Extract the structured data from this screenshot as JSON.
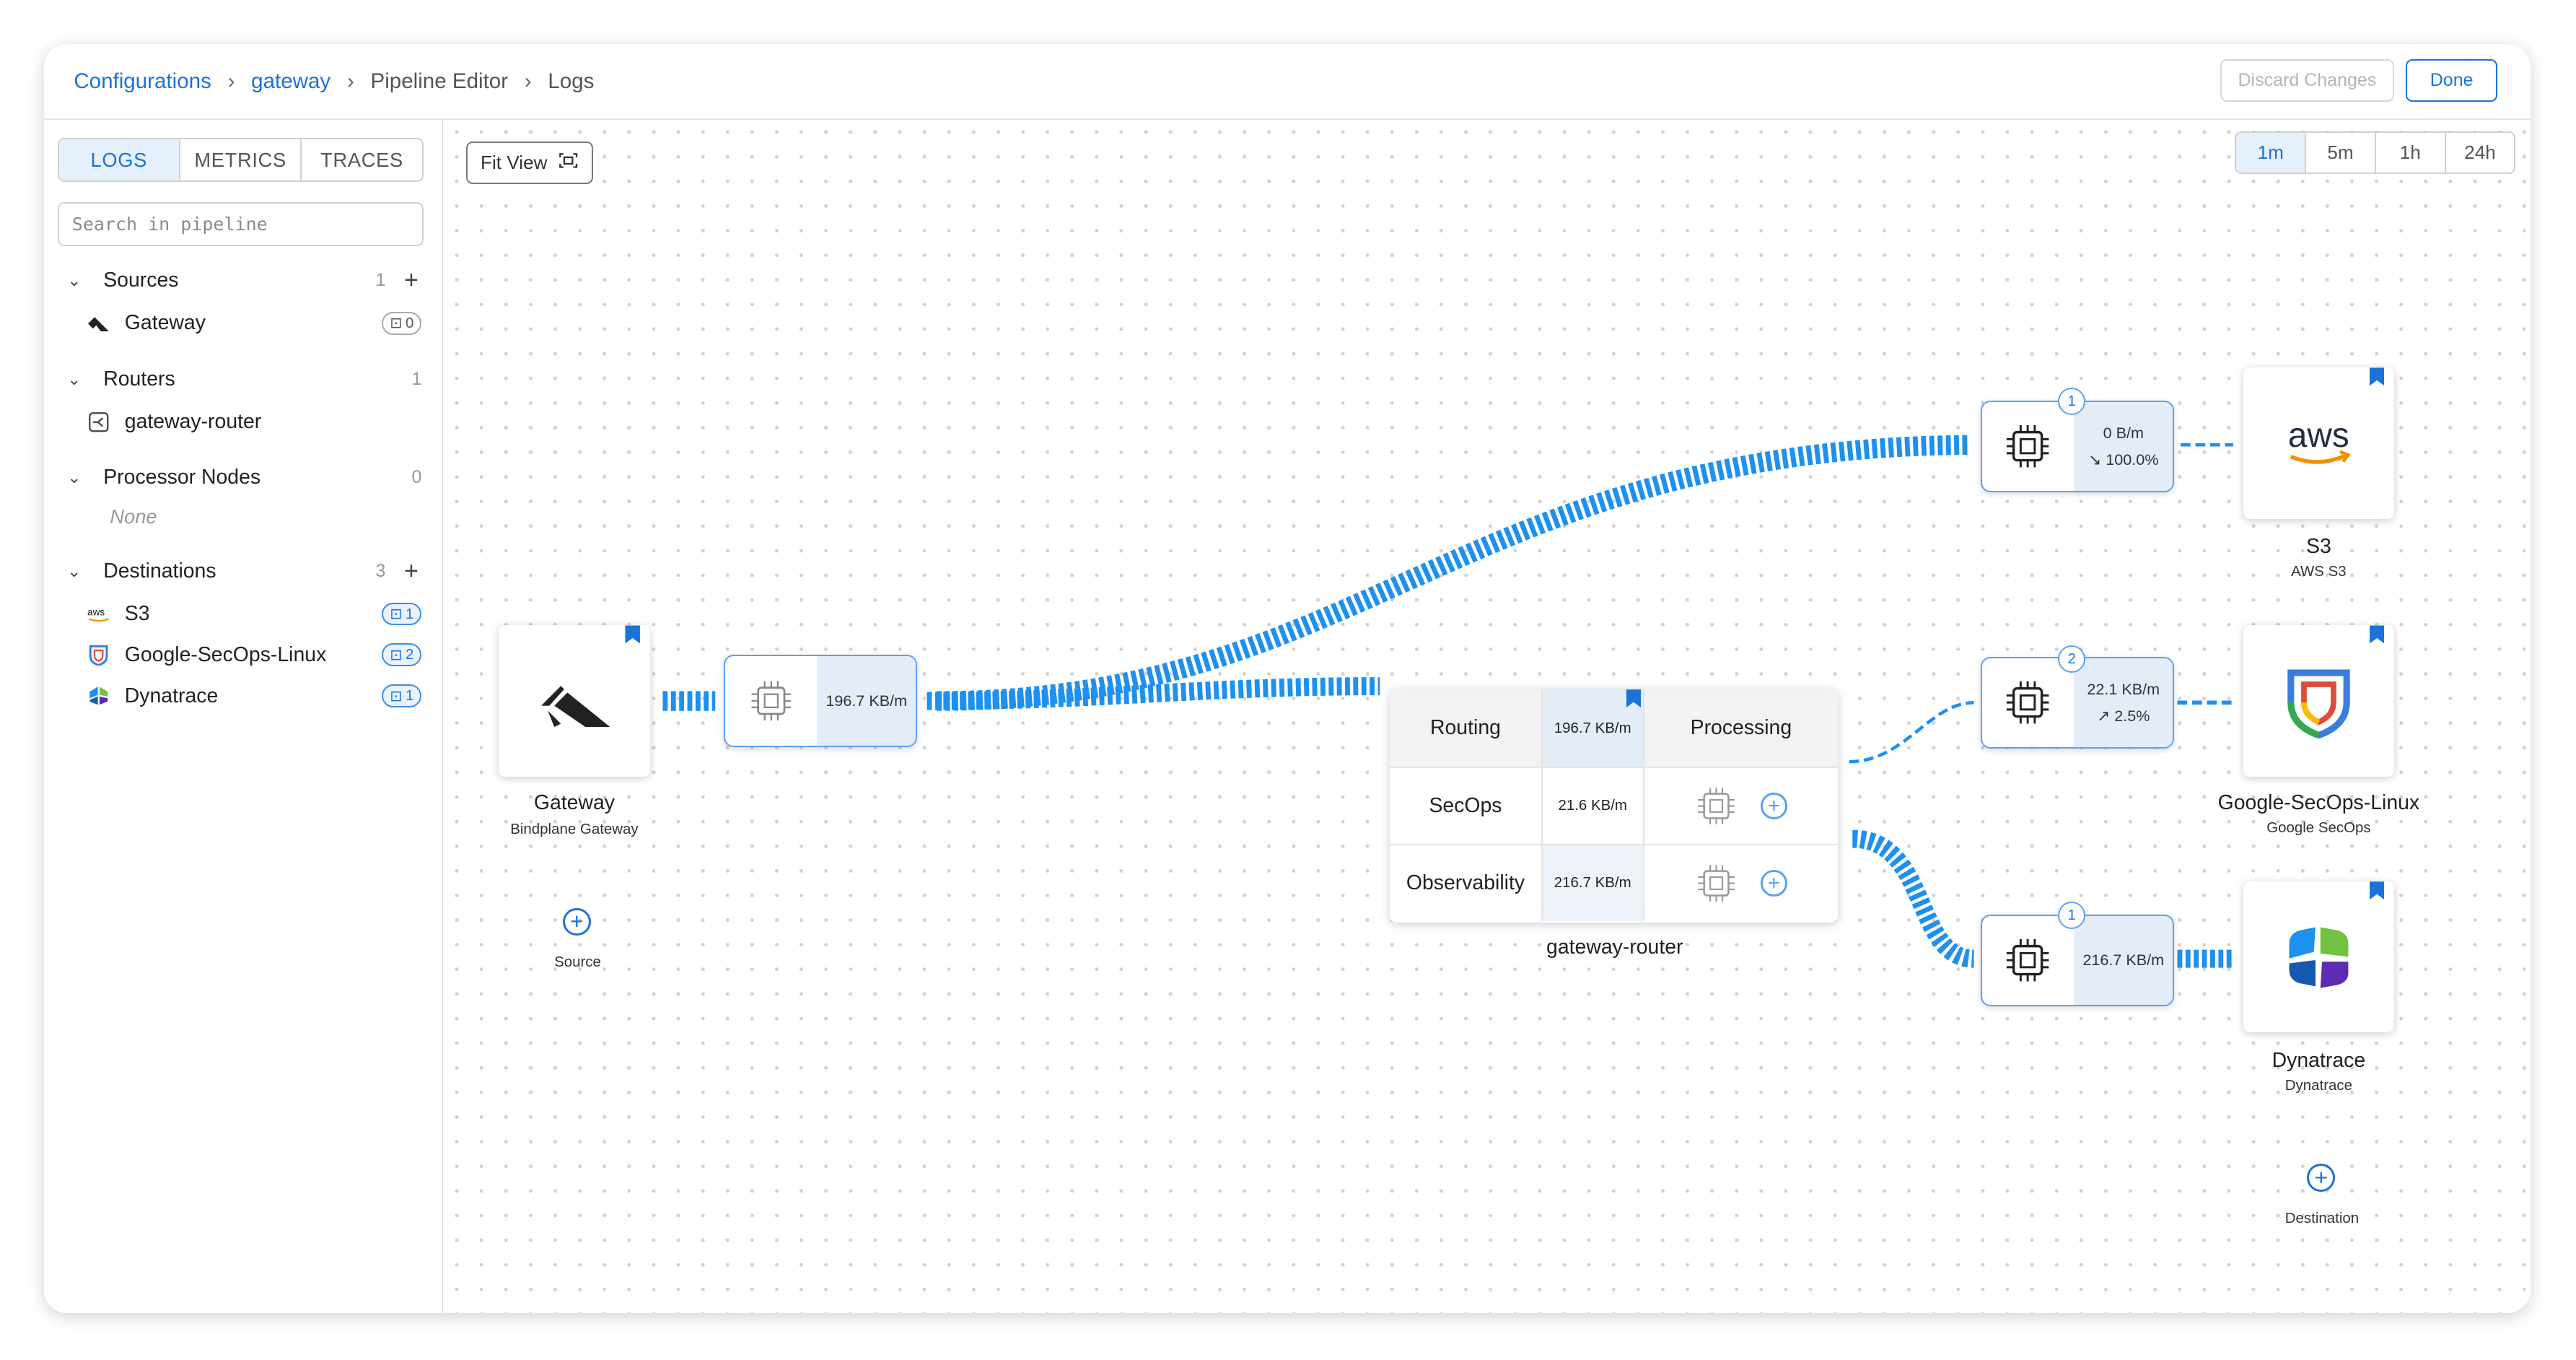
{
  "breadcrumb": {
    "items": [
      "Configurations",
      "gateway",
      "Pipeline Editor",
      "Logs"
    ]
  },
  "header": {
    "discard_label": "Discard Changes",
    "done_label": "Done"
  },
  "sidebar": {
    "tabs": [
      "LOGS",
      "METRICS",
      "TRACES"
    ],
    "active_tab": "LOGS",
    "search_placeholder": "Search in pipeline",
    "sections": {
      "sources": {
        "label": "Sources",
        "count": "1",
        "items": [
          {
            "label": "Gateway",
            "badge": "0"
          }
        ]
      },
      "routers": {
        "label": "Routers",
        "count": "1",
        "items": [
          {
            "label": "gateway-router"
          }
        ]
      },
      "processors": {
        "label": "Processor Nodes",
        "count": "0",
        "empty": "None"
      },
      "destinations": {
        "label": "Destinations",
        "count": "3",
        "items": [
          {
            "label": "S3",
            "badge": "1"
          },
          {
            "label": "Google-SecOps-Linux",
            "badge": "2"
          },
          {
            "label": "Dynatrace",
            "badge": "1"
          }
        ]
      }
    }
  },
  "canvas": {
    "fit_view_label": "Fit View",
    "time_options": [
      "1m",
      "5m",
      "1h",
      "24h"
    ],
    "active_time": "1m",
    "source_node": {
      "title": "Gateway",
      "subtitle": "Bindplane Gateway"
    },
    "source_processor": {
      "metric": "196.7 KB/m"
    },
    "add_source_label": "Source",
    "router": {
      "name": "gateway-router",
      "header": {
        "routing": "Routing",
        "rate": "196.7 KB/m",
        "processing": "Processing"
      },
      "routes": [
        {
          "label": "SecOps",
          "rate": "21.6 KB/m"
        },
        {
          "label": "Observability",
          "rate": "216.7 KB/m"
        }
      ]
    },
    "dest_processors": [
      {
        "num": "1",
        "line1": "0 B/m",
        "line2": "100.0%",
        "arrow": "↘"
      },
      {
        "num": "2",
        "line1": "22.1 KB/m",
        "line2": "2.5%",
        "arrow": "↗"
      },
      {
        "num": "1",
        "line1": "216.7 KB/m",
        "line2": ""
      }
    ],
    "destinations": [
      {
        "title": "S3",
        "subtitle": "AWS S3",
        "logo_text": "aws"
      },
      {
        "title": "Google-SecOps-Linux",
        "subtitle": "Google SecOps"
      },
      {
        "title": "Dynatrace",
        "subtitle": "Dynatrace"
      }
    ],
    "add_destination_label": "Destination"
  },
  "colors": {
    "accent": "#1a73d8",
    "flow": "#1e90f0"
  }
}
